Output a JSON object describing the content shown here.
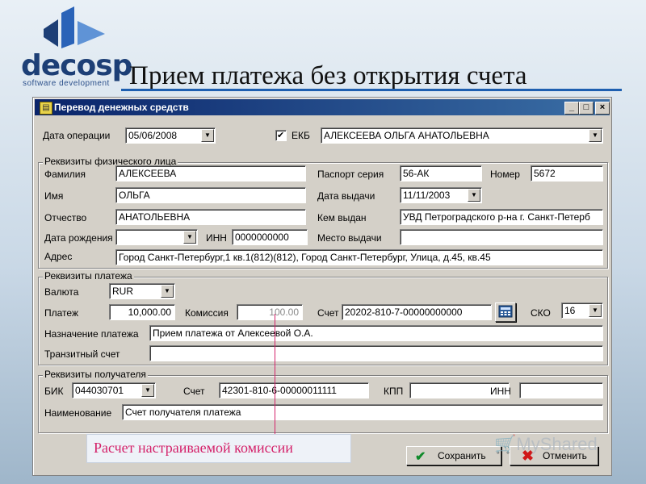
{
  "branding": {
    "logo_text": "decosp",
    "logo_subtitle": "software development"
  },
  "slide": {
    "title": "Прием платежа без открытия счета"
  },
  "window": {
    "title": "Перевод денежных средств",
    "min": "_",
    "max": "□",
    "close": "×"
  },
  "top": {
    "date_op_label": "Дата операции",
    "date_op_value": "05/06/2008",
    "ekb_label": "ЕКБ",
    "ekb_checked": "✔",
    "client_value": "АЛЕКСЕЕВА ОЛЬГА АНАТОЛЬЕВНА"
  },
  "person": {
    "group_title": "Реквизиты физического лица",
    "surname_label": "Фамилия",
    "surname": "АЛЕКСЕЕВА",
    "name_label": "Имя",
    "name": "ОЛЬГА",
    "patronymic_label": "Отчество",
    "patronymic": "АНАТОЛЬЕВНА",
    "birth_label": "Дата рождения",
    "birth": "",
    "inn_label": "ИНН",
    "inn": "0000000000",
    "address_label": "Адрес",
    "address": "Город Санкт-Петербург,1 кв.1(812)(812), Город Санкт-Петербург, Улица, д.45, кв.45",
    "passport_series_label": "Паспорт серия",
    "passport_series": "56-АК",
    "number_label": "Номер",
    "number": "5672",
    "issue_date_label": "Дата выдачи",
    "issue_date": "11/11/2003",
    "issued_by_label": "Кем выдан",
    "issued_by": "УВД Петроградского р-на г. Санкт-Петерб",
    "issue_place_label": "Место выдачи",
    "issue_place": ""
  },
  "payment": {
    "group_title": "Реквизиты платежа",
    "currency_label": "Валюта",
    "currency": "RUR",
    "amount_label": "Платеж",
    "amount": "10,000.00",
    "commission_label": "Комиссия",
    "commission": "100.00",
    "account_label": "Счет",
    "account": "20202-810-7-00000000000",
    "sko_label": "СКО",
    "sko": "16",
    "purpose_label": "Назначение платежа",
    "purpose": "Прием платежа от Алексеевой О.А.",
    "transit_label": "Транзитный счет",
    "transit": ""
  },
  "recipient": {
    "group_title": "Реквизиты получателя",
    "bik_label": "БИК",
    "bik": "044030701",
    "account_label": "Счет",
    "account": "42301-810-6-00000011111",
    "kpp_label": "КПП",
    "kpp": "",
    "inn_label": "ИНН",
    "inn": "",
    "name_label": "Наименование",
    "name": "Счет получателя платежа"
  },
  "buttons": {
    "save": "Сохранить",
    "cancel": "Отменить"
  },
  "annotation": {
    "text": "Расчет настраиваемой комиссии"
  },
  "watermark": {
    "text": "MyShared"
  },
  "colors": {
    "title_bar": "#0a246a",
    "annotation": "#d4226a",
    "logo": "#1d3f76"
  }
}
